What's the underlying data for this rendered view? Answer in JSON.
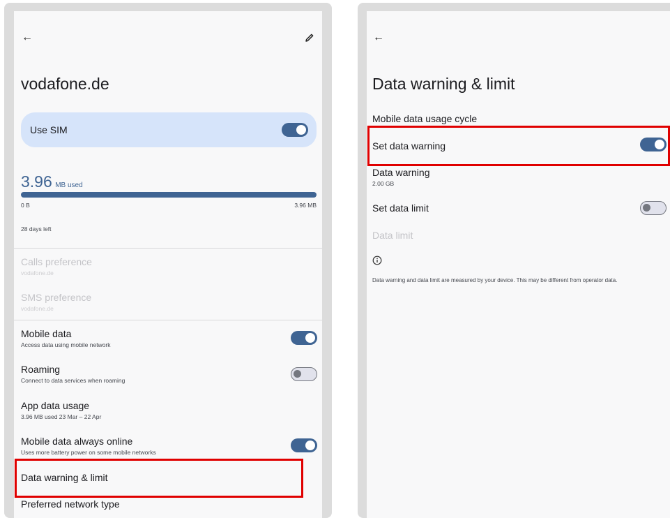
{
  "left": {
    "title": "vodafone.de",
    "use_sim": {
      "label": "Use SIM",
      "enabled": true
    },
    "usage": {
      "amount": "3.96",
      "unit": "MB used",
      "progress": 1.0,
      "min_label": "0 B",
      "max_label": "3.96 MB",
      "days_left": "28 days left"
    },
    "calls_preference": {
      "title": "Calls preference",
      "subtitle": "vodafone.de"
    },
    "sms_preference": {
      "title": "SMS preference",
      "subtitle": "vodafone.de"
    },
    "mobile_data": {
      "title": "Mobile data",
      "subtitle": "Access data using mobile network",
      "enabled": true
    },
    "roaming": {
      "title": "Roaming",
      "subtitle": "Connect to data services when roaming",
      "enabled": false
    },
    "app_data_usage": {
      "title": "App data usage",
      "subtitle": "3.96 MB used 23 Mar – 22 Apr"
    },
    "always_online": {
      "title": "Mobile data always online",
      "subtitle": "Uses more battery power on some mobile networks",
      "enabled": true
    },
    "data_warning_limit": {
      "title": "Data warning & limit"
    },
    "preferred_network": {
      "title": "Preferred network type"
    }
  },
  "right": {
    "title": "Data warning & limit",
    "usage_cycle": {
      "title": "Mobile data usage cycle"
    },
    "set_data_warning": {
      "title": "Set data warning",
      "enabled": true
    },
    "data_warning": {
      "title": "Data warning",
      "subtitle": "2.00 GB"
    },
    "set_data_limit": {
      "title": "Set data limit",
      "enabled": false
    },
    "data_limit": {
      "title": "Data limit"
    },
    "info_text": "Data warning and data limit are measured by your device. This may be different from operator data."
  },
  "colors": {
    "accent": "#3f6493",
    "sim_card_bg": "#d6e4fa",
    "highlight": "#e00000",
    "frame": "#dcdcdc",
    "screen_bg": "#f8f8f9"
  },
  "icons": {
    "back": "arrow-left",
    "edit": "pencil",
    "info": "info-circle"
  }
}
